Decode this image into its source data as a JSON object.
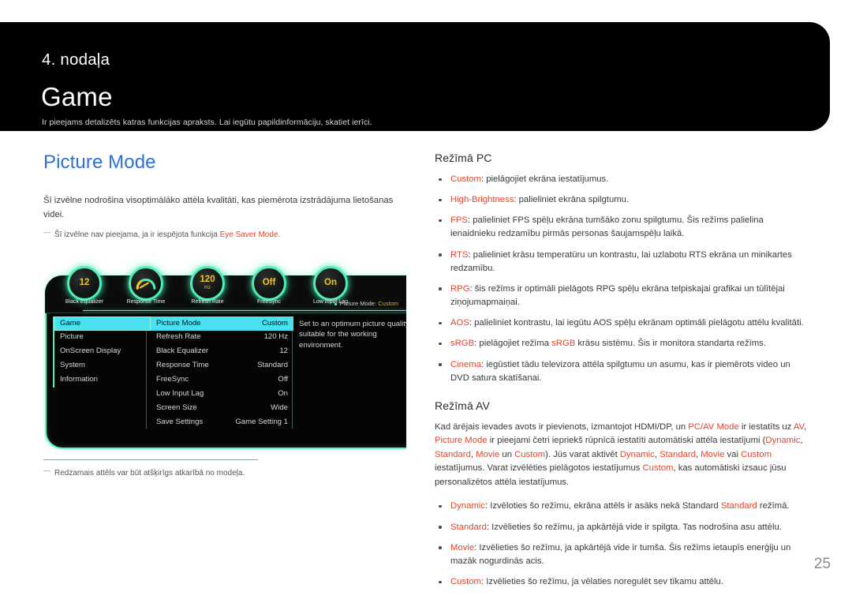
{
  "header": {
    "chapter_label": "4. nodaļa",
    "chapter_title": "Game",
    "chapter_sub": "Ir pieejams detalizēts katras funkcijas apraksts. Lai iegūtu papildinformāciju, skatiet ierīci."
  },
  "left": {
    "section_title": "Picture Mode",
    "intro": "Šī izvēlne nodrošina visoptimālāko attēla kvalitāti, kas piemērota izstrādājuma lietošanas videi.",
    "note_prefix": "Šī izvēlne nav pieejama, ja ir iespējota funkcija ",
    "note_accent": "Eye Saver Mode",
    "note_suffix": ".",
    "footnote": "Redzamais attēls var būt atšķirīgs atkarībā no modeļa."
  },
  "osd": {
    "dials": [
      {
        "value": "12",
        "unit": "",
        "label": "Black Equalizer",
        "kind": "value"
      },
      {
        "value": "",
        "unit": "",
        "label": "Response Time",
        "kind": "gauge"
      },
      {
        "value": "120",
        "unit": "Hz",
        "label": "Refresh Rate",
        "kind": "value"
      },
      {
        "value": "Off",
        "unit": "",
        "label": "FreeSync",
        "kind": "value"
      },
      {
        "value": "On",
        "unit": "",
        "label": "Low Input Lag",
        "kind": "value"
      }
    ],
    "breadcrumb_label": "Picture Mode:",
    "breadcrumb_value": "Custom",
    "menu_categories": [
      {
        "label": "Game",
        "selected": true
      },
      {
        "label": "Picture",
        "selected": false
      },
      {
        "label": "OnScreen Display",
        "selected": false
      },
      {
        "label": "System",
        "selected": false
      },
      {
        "label": "Information",
        "selected": false
      }
    ],
    "menu_items": [
      {
        "label": "Picture Mode",
        "value": "Custom",
        "selected": true
      },
      {
        "label": "Refresh Rate",
        "value": "120 Hz",
        "selected": false
      },
      {
        "label": "Black Equalizer",
        "value": "12",
        "selected": false
      },
      {
        "label": "Response Time",
        "value": "Standard",
        "selected": false
      },
      {
        "label": "FreeSync",
        "value": "Off",
        "selected": false
      },
      {
        "label": "Low Input Lag",
        "value": "On",
        "selected": false
      },
      {
        "label": "Screen Size",
        "value": "Wide",
        "selected": false
      },
      {
        "label": "Save Settings",
        "value": "Game Setting 1",
        "selected": false
      }
    ],
    "description": "Set to an optimum picture quality suitable for the working environment."
  },
  "right": {
    "pc_title": "Režīmā PC",
    "pc_bullets": [
      {
        "term": "Custom",
        "text": ": pielāgojiet ekrāna iestatījumus."
      },
      {
        "term": "High-Brightness",
        "text": ": palieliniet ekrāna spilgtumu."
      },
      {
        "term": "FPS",
        "text": ": palieliniet FPS spēļu ekrāna tumšāko zonu spilgtumu. Šis režīms palielina ienaidnieku redzamību pirmās personas šaujamspēļu laikā."
      },
      {
        "term": "RTS",
        "text": ": palieliniet krāsu temperatūru un kontrastu, lai uzlabotu RTS ekrāna un minikartes redzamību."
      },
      {
        "term": "RPG",
        "text": ": šis režīms ir optimāli pielāgots RPG spēļu ekrāna telpiskajai grafikai un tūlītējai ziņojumapmaiņai."
      },
      {
        "term": "AOS",
        "text": ": palieliniet kontrastu, lai iegūtu AOS spēļu ekrānam optimāli pielāgotu attēlu kvalitāti."
      },
      {
        "term": "sRGB",
        "text": ": pielāgojiet režīma ",
        "term2": "sRGB",
        "text2": " krāsu sistēmu. Šis ir monitora standarta režīms."
      },
      {
        "term": "Cinema",
        "text": ": iegūstiet tādu televizora attēla spilgtumu un asumu, kas ir piemērots video un DVD satura skatīšanai."
      }
    ],
    "av_title": "Režīmā AV",
    "av_paragraph": {
      "p1": "Kad ārējais ievades avots ir pievienots, izmantojot HDMI/DP, un ",
      "a1": "PC/AV Mode",
      "p2": " ir iestatīts uz ",
      "a2": "AV",
      "p3": ", ",
      "a3": "Picture Mode",
      "p4": " ir pieejami četri iepriekš rūpnīcā iestatīti automātiski attēla iestatījumi (",
      "a4": "Dynamic",
      "p5": ", ",
      "a5": "Standard",
      "p6": ", ",
      "a6": "Movie",
      "p7": " un ",
      "a7": "Custom",
      "p8": "). Jūs varat aktivēt ",
      "a8": "Dynamic",
      "p9": ", ",
      "a9": "Standard",
      "p10": ", ",
      "a10": "Movie",
      "p11": " vai ",
      "a11": "Custom",
      "p12": " iestatījumus. Varat izvēlēties pielāgotos iestatījumus ",
      "a12": "Custom",
      "p13": ", kas automātiski izsauc jūsu personalizētos attēla iestatījumus."
    },
    "av_bullets": [
      {
        "term": "Dynamic",
        "text": ": Izvēloties šo režīmu, ekrāna attēls ir asāks nekā Standard ",
        "term2": "Standard",
        "text2": " režīmā."
      },
      {
        "term": "Standard",
        "text": ": Izvēlieties šo režīmu, ja apkārtējā vide ir spilgta. Tas nodrošina asu attēlu."
      },
      {
        "term": "Movie",
        "text": ": Izvēlieties šo režīmu, ja apkārtējā vide ir tumša. Šis režīms ietaupīs enerģiju un mazāk nogurdinās acis."
      },
      {
        "term": "Custom",
        "text": ": Izvēlieties šo režīmu, ja vēlaties noregulēt sev tīkamu attēlu."
      }
    ]
  },
  "page_number": "25",
  "colors": {
    "accent_red": "#e8442a",
    "heading_blue": "#2e6fd9",
    "osd_green": "#4ef0b8",
    "osd_highlight": "#4ae0f0",
    "osd_yellow": "#f2c21e"
  }
}
